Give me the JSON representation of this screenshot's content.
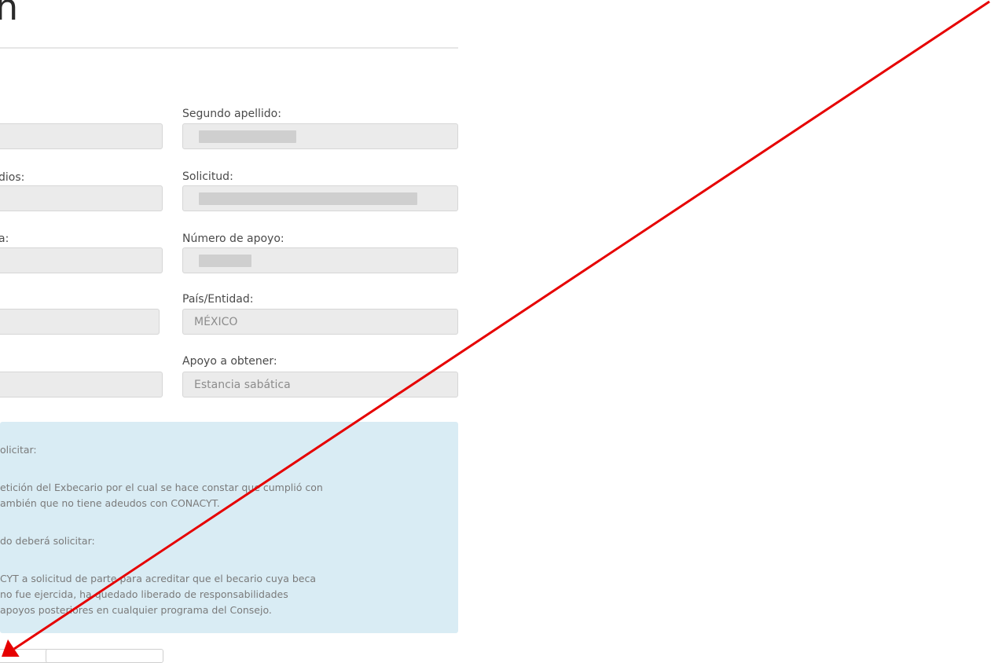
{
  "page": {
    "title_fragment": "n"
  },
  "fields": {
    "segundo_apellido_label": "Segundo apellido:",
    "segundo_apellido_value": "",
    "solicitud_label": "Solicitud:",
    "solicitud_value": "",
    "numero_apoyo_label": "Número de apoyo:",
    "numero_apoyo_value": "",
    "pais_label": "País/Entidad:",
    "pais_value": "MÉXICO",
    "apoyo_label": "Apoyo a obtener:",
    "apoyo_value": "Estancia sabática",
    "left_label_2": "dios:",
    "left_label_3": "a:"
  },
  "info": {
    "line1": "olicitar:",
    "line2": "etición del Exbecario por el cual se hace constar que cumplió con",
    "line3": "ambién que no tiene adeudos con CONACYT.",
    "line4": "do deberá solicitar:",
    "line5": "CYT a solicitud de parte para acreditar que el becario cuya beca",
    "line6": "  no fue ejercida, ha quedado liberado de responsabilidades",
    "line7": "apoyos posteriores en cualquier programa del Consejo."
  },
  "colors": {
    "arrow": "#e60000",
    "info_bg": "#d9ecf4",
    "input_bg": "#ebebeb"
  }
}
